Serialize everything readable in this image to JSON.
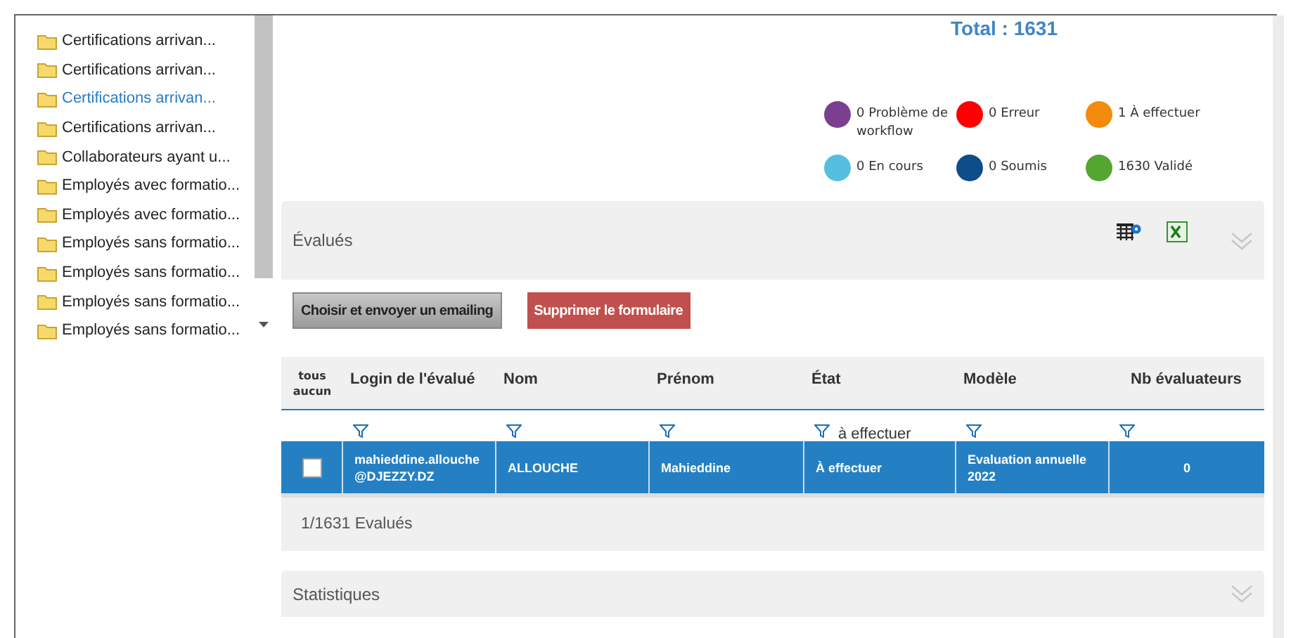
{
  "tree": {
    "items": [
      {
        "label": "Certifications arrivan...",
        "selected": false
      },
      {
        "label": "Certifications arrivan...",
        "selected": false
      },
      {
        "label": "Certifications arrivan...",
        "selected": true
      },
      {
        "label": "Certifications arrivan...",
        "selected": false
      },
      {
        "label": "Collaborateurs ayant u...",
        "selected": false
      },
      {
        "label": "Employés avec formatio...",
        "selected": false
      },
      {
        "label": "Employés avec formatio...",
        "selected": false
      },
      {
        "label": "Employés sans formatio...",
        "selected": false
      },
      {
        "label": "Employés sans formatio...",
        "selected": false
      },
      {
        "label": "Employés sans formatio...",
        "selected": false
      },
      {
        "label": "Employés sans formatio...",
        "selected": false
      }
    ]
  },
  "total": "Total : 1631",
  "legend": [
    {
      "label": "0 Problème de workflow",
      "color": "#7b3f8f"
    },
    {
      "label": "0 Erreur",
      "color": "#ff0000"
    },
    {
      "label": "1 À effectuer",
      "color": "#f28a0b"
    },
    {
      "label": "0 En cours",
      "color": "#55bfe0"
    },
    {
      "label": "0 Soumis",
      "color": "#0e4d87"
    },
    {
      "label": "1630 Validé",
      "color": "#55a630"
    }
  ],
  "panel": {
    "title": "Évalués",
    "expanded": true
  },
  "buttons": [
    {
      "label": "Choisir et envoyer un emailing",
      "kind": "neutral"
    },
    {
      "label": "Supprimer le formulaire",
      "kind": "danger"
    }
  ],
  "table": {
    "select_all": "tous",
    "select_none": "aucun",
    "columns": [
      {
        "label": "Login de l'évalué"
      },
      {
        "label": "Nom"
      },
      {
        "label": "Prénom"
      },
      {
        "label": "État",
        "filter": "à effectuer"
      },
      {
        "label": "Modèle"
      },
      {
        "label": "Nb évaluateurs"
      }
    ],
    "rows": [
      {
        "selected": true,
        "checked": false,
        "cells": [
          "mahieddine.allouche@DJEZZY.DZ",
          "ALLOUCHE",
          "Mahieddine",
          "À effectuer",
          "Evaluation annuelle 2022",
          "0"
        ]
      }
    ],
    "footer": "1/1631 Evalués"
  },
  "stats_panel": {
    "title": "Statistiques",
    "expanded": false
  }
}
